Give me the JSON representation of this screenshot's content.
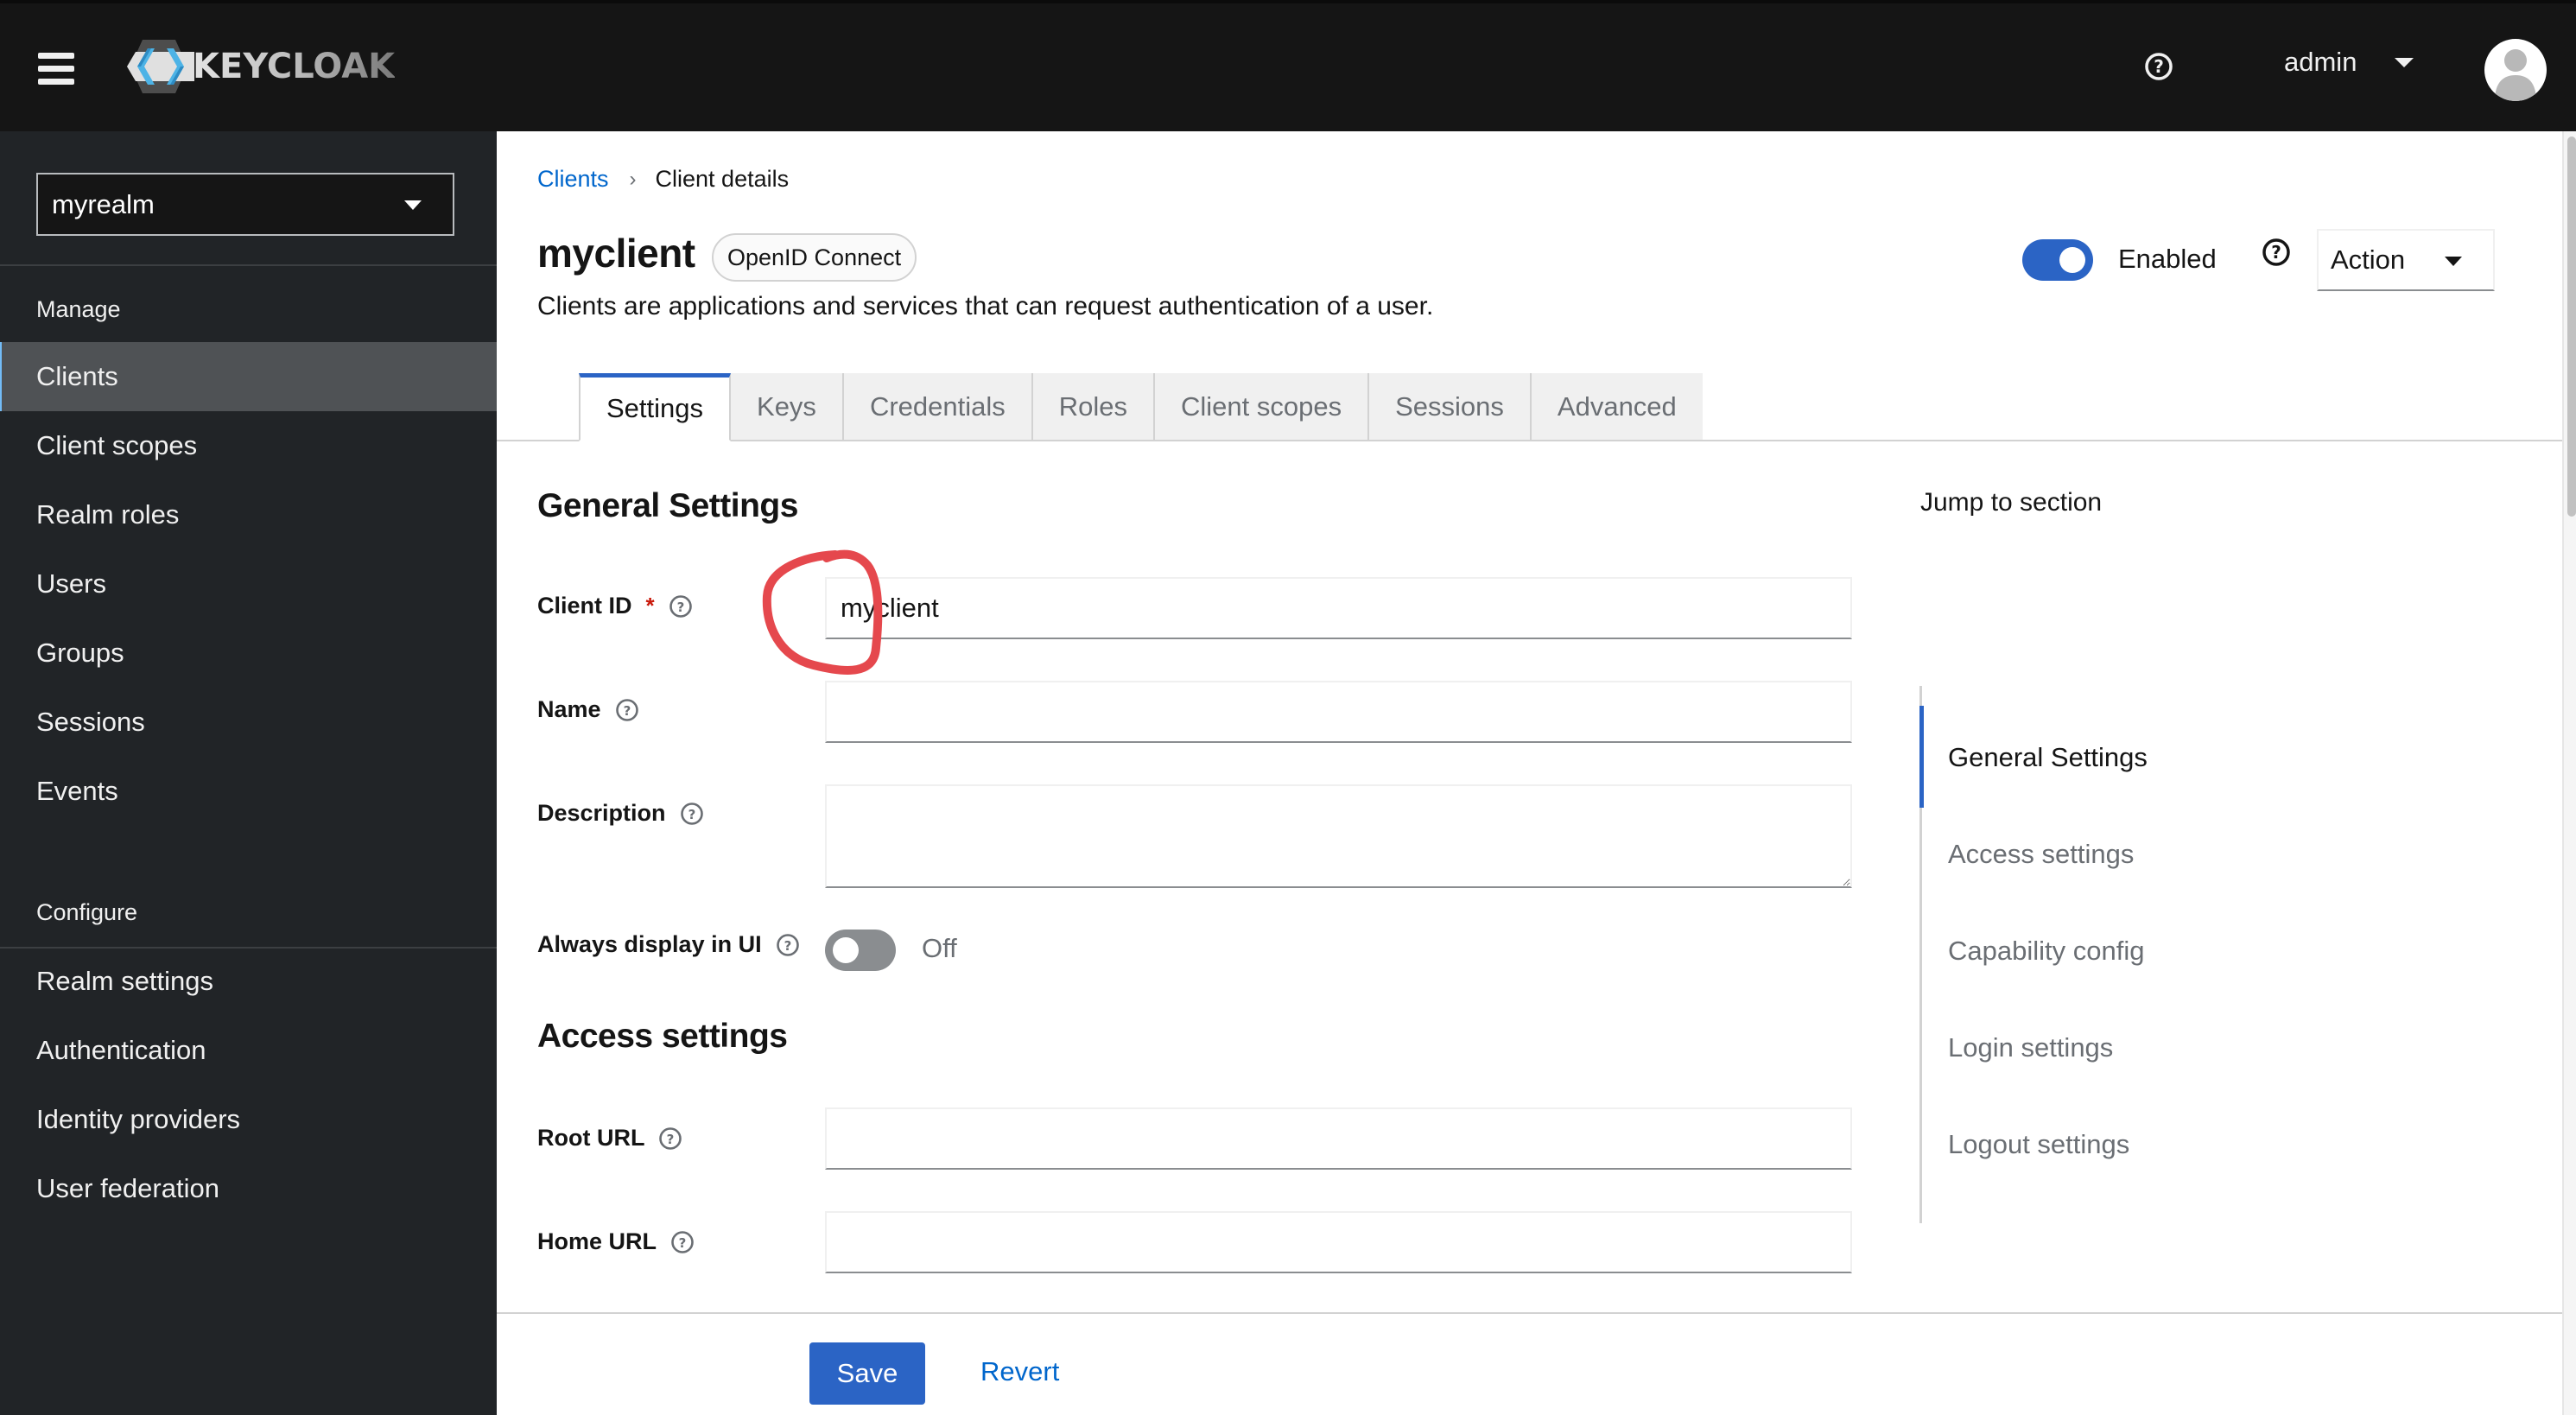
{
  "header": {
    "brand": "KEYCLOAK",
    "menu_icon": "hamburger-menu-icon",
    "help_icon": "help-circle-icon",
    "user_name": "admin",
    "avatar_icon": "user-avatar-icon"
  },
  "sidebar": {
    "realm": "myrealm",
    "groups": [
      {
        "label": "Manage",
        "items": [
          {
            "label": "Clients",
            "active": true
          },
          {
            "label": "Client scopes"
          },
          {
            "label": "Realm roles"
          },
          {
            "label": "Users"
          },
          {
            "label": "Groups"
          },
          {
            "label": "Sessions"
          },
          {
            "label": "Events"
          }
        ]
      },
      {
        "label": "Configure",
        "items": [
          {
            "label": "Realm settings"
          },
          {
            "label": "Authentication"
          },
          {
            "label": "Identity providers"
          },
          {
            "label": "User federation"
          }
        ]
      }
    ]
  },
  "breadcrumb": {
    "parent": "Clients",
    "current": "Client details"
  },
  "page": {
    "title": "myclient",
    "protocol_badge": "OpenID Connect",
    "description": "Clients are applications and services that can request authentication of a user.",
    "enabled_label": "Enabled",
    "enabled": true,
    "action_label": "Action"
  },
  "tabs": [
    {
      "label": "Settings",
      "active": true
    },
    {
      "label": "Keys"
    },
    {
      "label": "Credentials"
    },
    {
      "label": "Roles"
    },
    {
      "label": "Client scopes"
    },
    {
      "label": "Sessions"
    },
    {
      "label": "Advanced"
    }
  ],
  "form": {
    "general_title": "General Settings",
    "client_id_label": "Client ID",
    "required_mark": "*",
    "client_id_value": "myclient",
    "name_label": "Name",
    "name_value": "",
    "description_label": "Description",
    "description_value": "",
    "always_display_label": "Always display in UI",
    "always_display_state": "Off",
    "access_title": "Access settings",
    "root_url_label": "Root URL",
    "root_url_value": "",
    "home_url_label": "Home URL",
    "home_url_value": ""
  },
  "jump": {
    "title": "Jump to section",
    "items": [
      {
        "label": "General Settings",
        "active": true
      },
      {
        "label": "Access settings"
      },
      {
        "label": "Capability config"
      },
      {
        "label": "Login settings"
      },
      {
        "label": "Logout settings"
      }
    ]
  },
  "footer": {
    "save_label": "Save",
    "revert_label": "Revert"
  },
  "colors": {
    "header_bg": "#151515",
    "sidebar_bg": "#212427",
    "sidebar_active_bg": "#4f5255",
    "accent_blue": "#2b64c5",
    "link_blue": "#0066cc",
    "required_red": "#c9190b",
    "annotation_red": "#e5484d"
  }
}
